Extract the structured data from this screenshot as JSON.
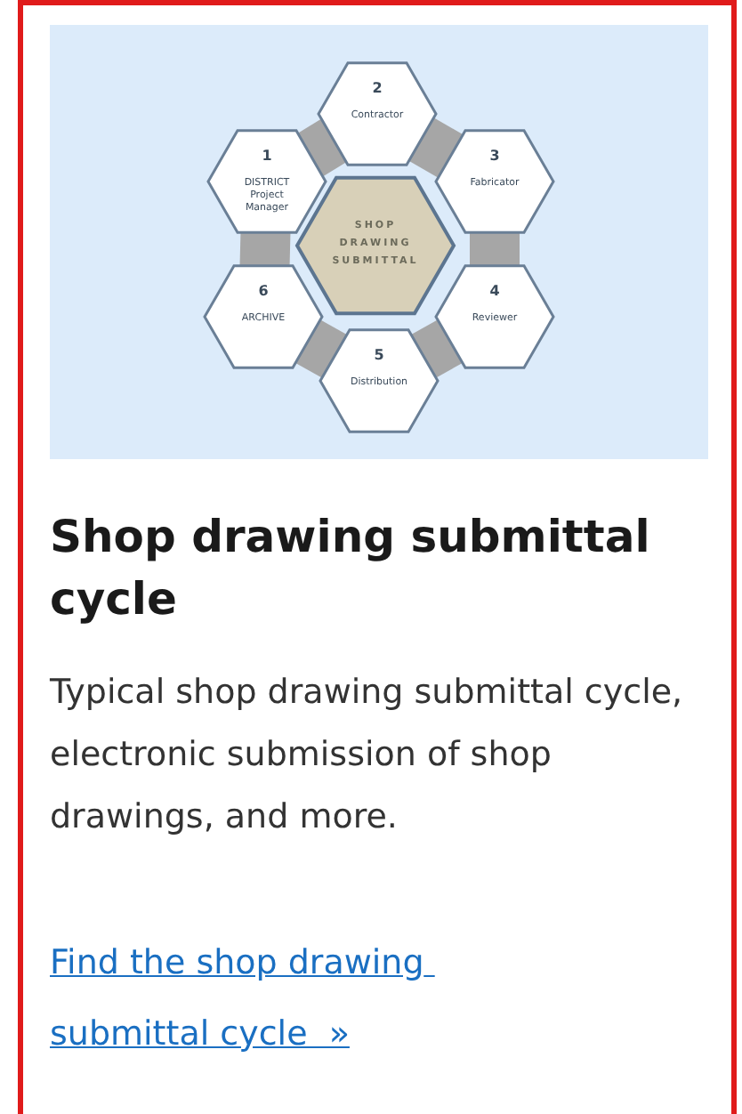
{
  "diagram": {
    "center_label": [
      "SHOP",
      "DRAWING",
      "SUBMITTAL"
    ],
    "steps": [
      {
        "number": "1",
        "lines": [
          "DISTRICT",
          "Project",
          "Manager"
        ]
      },
      {
        "number": "2",
        "lines": [
          "Contractor"
        ]
      },
      {
        "number": "3",
        "lines": [
          "Fabricator"
        ]
      },
      {
        "number": "4",
        "lines": [
          "Reviewer"
        ]
      },
      {
        "number": "5",
        "lines": [
          "Distribution"
        ]
      },
      {
        "number": "6",
        "lines": [
          "ARCHIVE"
        ]
      }
    ]
  },
  "title": "Shop drawing submittal cycle",
  "description": "Typical shop drawing submittal cycle, electronic submission of shop drawings, and more.",
  "link": "Find the shop drawing submittal cycle  »"
}
